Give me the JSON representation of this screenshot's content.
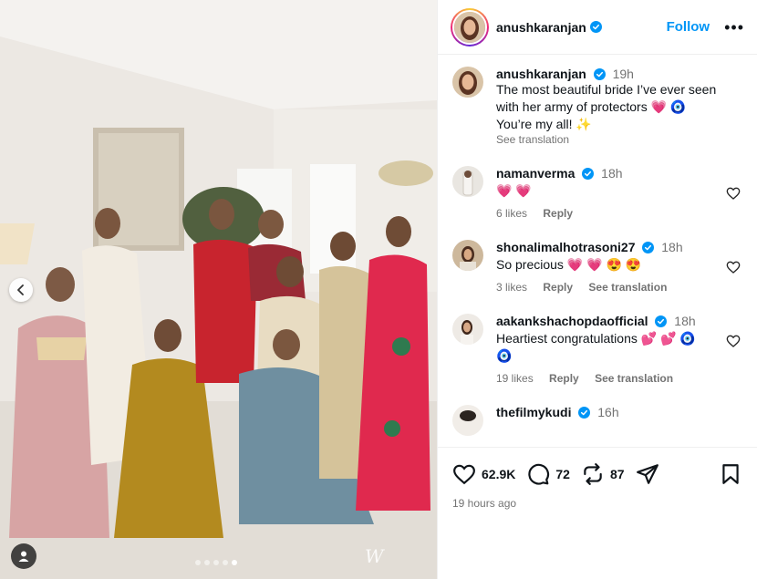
{
  "post": {
    "author": "anushkaranjan",
    "follow_label": "Follow",
    "more_label": "•••",
    "slides": 5,
    "active_slide": 5,
    "watermark": "W"
  },
  "caption": {
    "author": "anushkaranjan",
    "time": "19h",
    "line1": "The most beautiful bride I’ve ever seen",
    "line2": "with her army of protectors 💗 🧿",
    "line3": "You’re my all! ✨",
    "see_translation": "See translation"
  },
  "comments": [
    {
      "author": "namanverma",
      "time": "18h",
      "text": "💗 💗",
      "likes": "6 likes",
      "reply": "Reply"
    },
    {
      "author": "shonalimalhotrasoni27",
      "time": "18h",
      "text": "So precious 💗 💗 😍 😍",
      "likes": "3 likes",
      "reply": "Reply",
      "see_translation": "See translation"
    },
    {
      "author": "aakankshachopdaofficial",
      "time": "18h",
      "text": "Heartiest congratulations 💕 💕 🧿",
      "text2": "🧿",
      "likes": "19 likes",
      "reply": "Reply",
      "see_translation": "See translation"
    },
    {
      "author": "thefilmykudi",
      "time": "16h"
    }
  ],
  "actions": {
    "likes": "62.9K",
    "comments": "72",
    "reposts": "87"
  },
  "posted_ago": "19 hours ago",
  "colors": {
    "accent": "#0095f6",
    "verified": "#0095f6",
    "muted": "#737373"
  }
}
